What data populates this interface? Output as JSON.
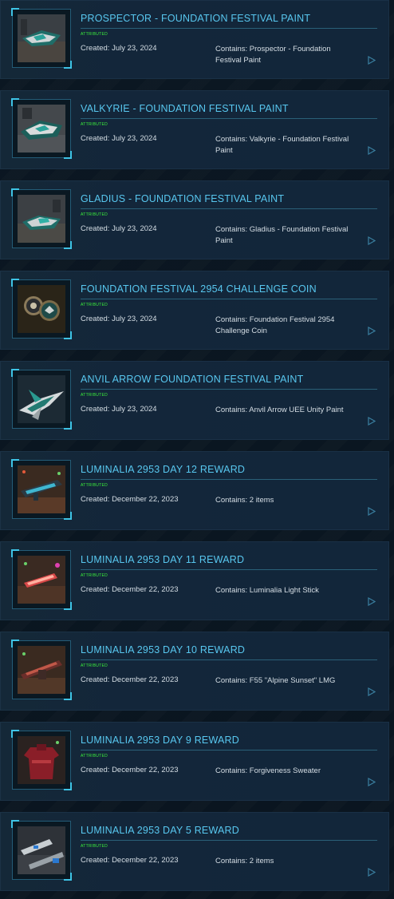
{
  "items": [
    {
      "title": "PROSPECTOR - FOUNDATION FESTIVAL PAINT",
      "badge": "ATTRIBUTED",
      "created": "Created: July 23, 2024",
      "contains": "Contains: Prospector - Foundation Festival Paint",
      "thumb_icon": "teal-ship-thumbnail"
    },
    {
      "title": "VALKYRIE - FOUNDATION FESTIVAL PAINT",
      "badge": "ATTRIBUTED",
      "created": "Created: July 23, 2024",
      "contains": "Contains: Valkyrie - Foundation Festival Paint",
      "thumb_icon": "teal-ship-thumbnail"
    },
    {
      "title": "GLADIUS - FOUNDATION FESTIVAL PAINT",
      "badge": "ATTRIBUTED",
      "created": "Created: July 23, 2024",
      "contains": "Contains: Gladius - Foundation Festival Paint",
      "thumb_icon": "teal-ship-thumbnail"
    },
    {
      "title": "FOUNDATION FESTIVAL 2954 CHALLENGE COIN",
      "badge": "ATTRIBUTED",
      "created": "Created: July 23, 2024",
      "contains": "Contains: Foundation Festival 2954 Challenge Coin",
      "thumb_icon": "challenge-coin-thumbnail"
    },
    {
      "title": "ANVIL ARROW FOUNDATION FESTIVAL PAINT",
      "badge": "ATTRIBUTED",
      "created": "Created: July 23, 2024",
      "contains": "Contains: Anvil Arrow UEE Unity Paint",
      "thumb_icon": "fighter-ship-thumbnail"
    },
    {
      "title": "LUMINALIA 2953 DAY 12 REWARD",
      "badge": "ATTRIBUTED",
      "created": "Created: December 22, 2023",
      "contains": "Contains: 2 items",
      "thumb_icon": "weapon-thumbnail"
    },
    {
      "title": "LUMINALIA 2953 DAY 11 REWARD",
      "badge": "ATTRIBUTED",
      "created": "Created: December 22, 2023",
      "contains": "Contains: Luminalia Light Stick",
      "thumb_icon": "light-stick-thumbnail"
    },
    {
      "title": "LUMINALIA 2953 DAY 10 REWARD",
      "badge": "ATTRIBUTED",
      "created": "Created: December 22, 2023",
      "contains": "Contains: F55 \"Alpine Sunset\" LMG",
      "thumb_icon": "lmg-thumbnail"
    },
    {
      "title": "LUMINALIA 2953 DAY 9 REWARD",
      "badge": "ATTRIBUTED",
      "created": "Created: December 22, 2023",
      "contains": "Contains: Forgiveness Sweater",
      "thumb_icon": "sweater-thumbnail"
    },
    {
      "title": "LUMINALIA 2953 DAY 5 REWARD",
      "badge": "ATTRIBUTED",
      "created": "Created: December 22, 2023",
      "contains": "Contains: 2 items",
      "thumb_icon": "weapons-thumbnail"
    }
  ],
  "colors": {
    "title": "#58c7ef",
    "badge": "#3cf23c",
    "text": "#d5dee5",
    "accent": "#3ec4e6"
  },
  "expand_icon": "play-arrow-icon"
}
